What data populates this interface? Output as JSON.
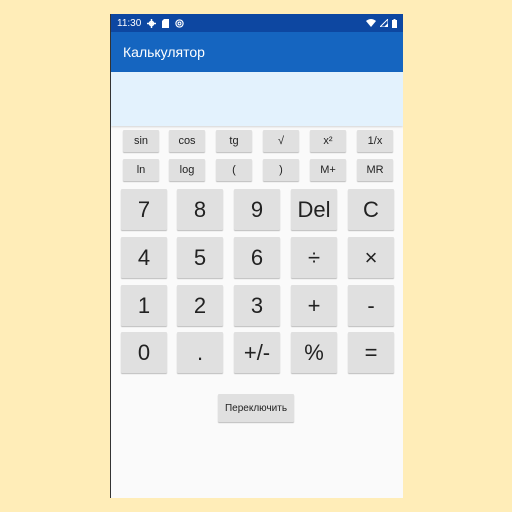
{
  "status_bar": {
    "time": "11:30",
    "left_icons": [
      "settings-icon",
      "sd-card-icon",
      "at-sign-icon"
    ],
    "right_icons": [
      "wifi-icon",
      "signal-icon",
      "battery-icon"
    ]
  },
  "app_bar": {
    "title": "Калькулятор"
  },
  "display": {
    "value": ""
  },
  "keypad": {
    "scientific_rows": [
      [
        "sin",
        "cos",
        "tg",
        "√",
        "x²",
        "1/x"
      ],
      [
        "ln",
        "log",
        "(",
        ")",
        "M+",
        "MR"
      ]
    ],
    "main_rows": [
      [
        "7",
        "8",
        "9",
        "Del",
        "C"
      ],
      [
        "4",
        "5",
        "6",
        "÷",
        "×"
      ],
      [
        "1",
        "2",
        "3",
        "+",
        "-"
      ],
      [
        "0",
        ".",
        "+/-",
        "%",
        "="
      ]
    ]
  },
  "toggle_button": {
    "label": "Переключить"
  },
  "colors": {
    "background": "#FFEDB8",
    "status_bar": "#0D47A1",
    "app_bar": "#1565C0",
    "display": "#E3F2FD",
    "key": "#E0E0E0"
  }
}
